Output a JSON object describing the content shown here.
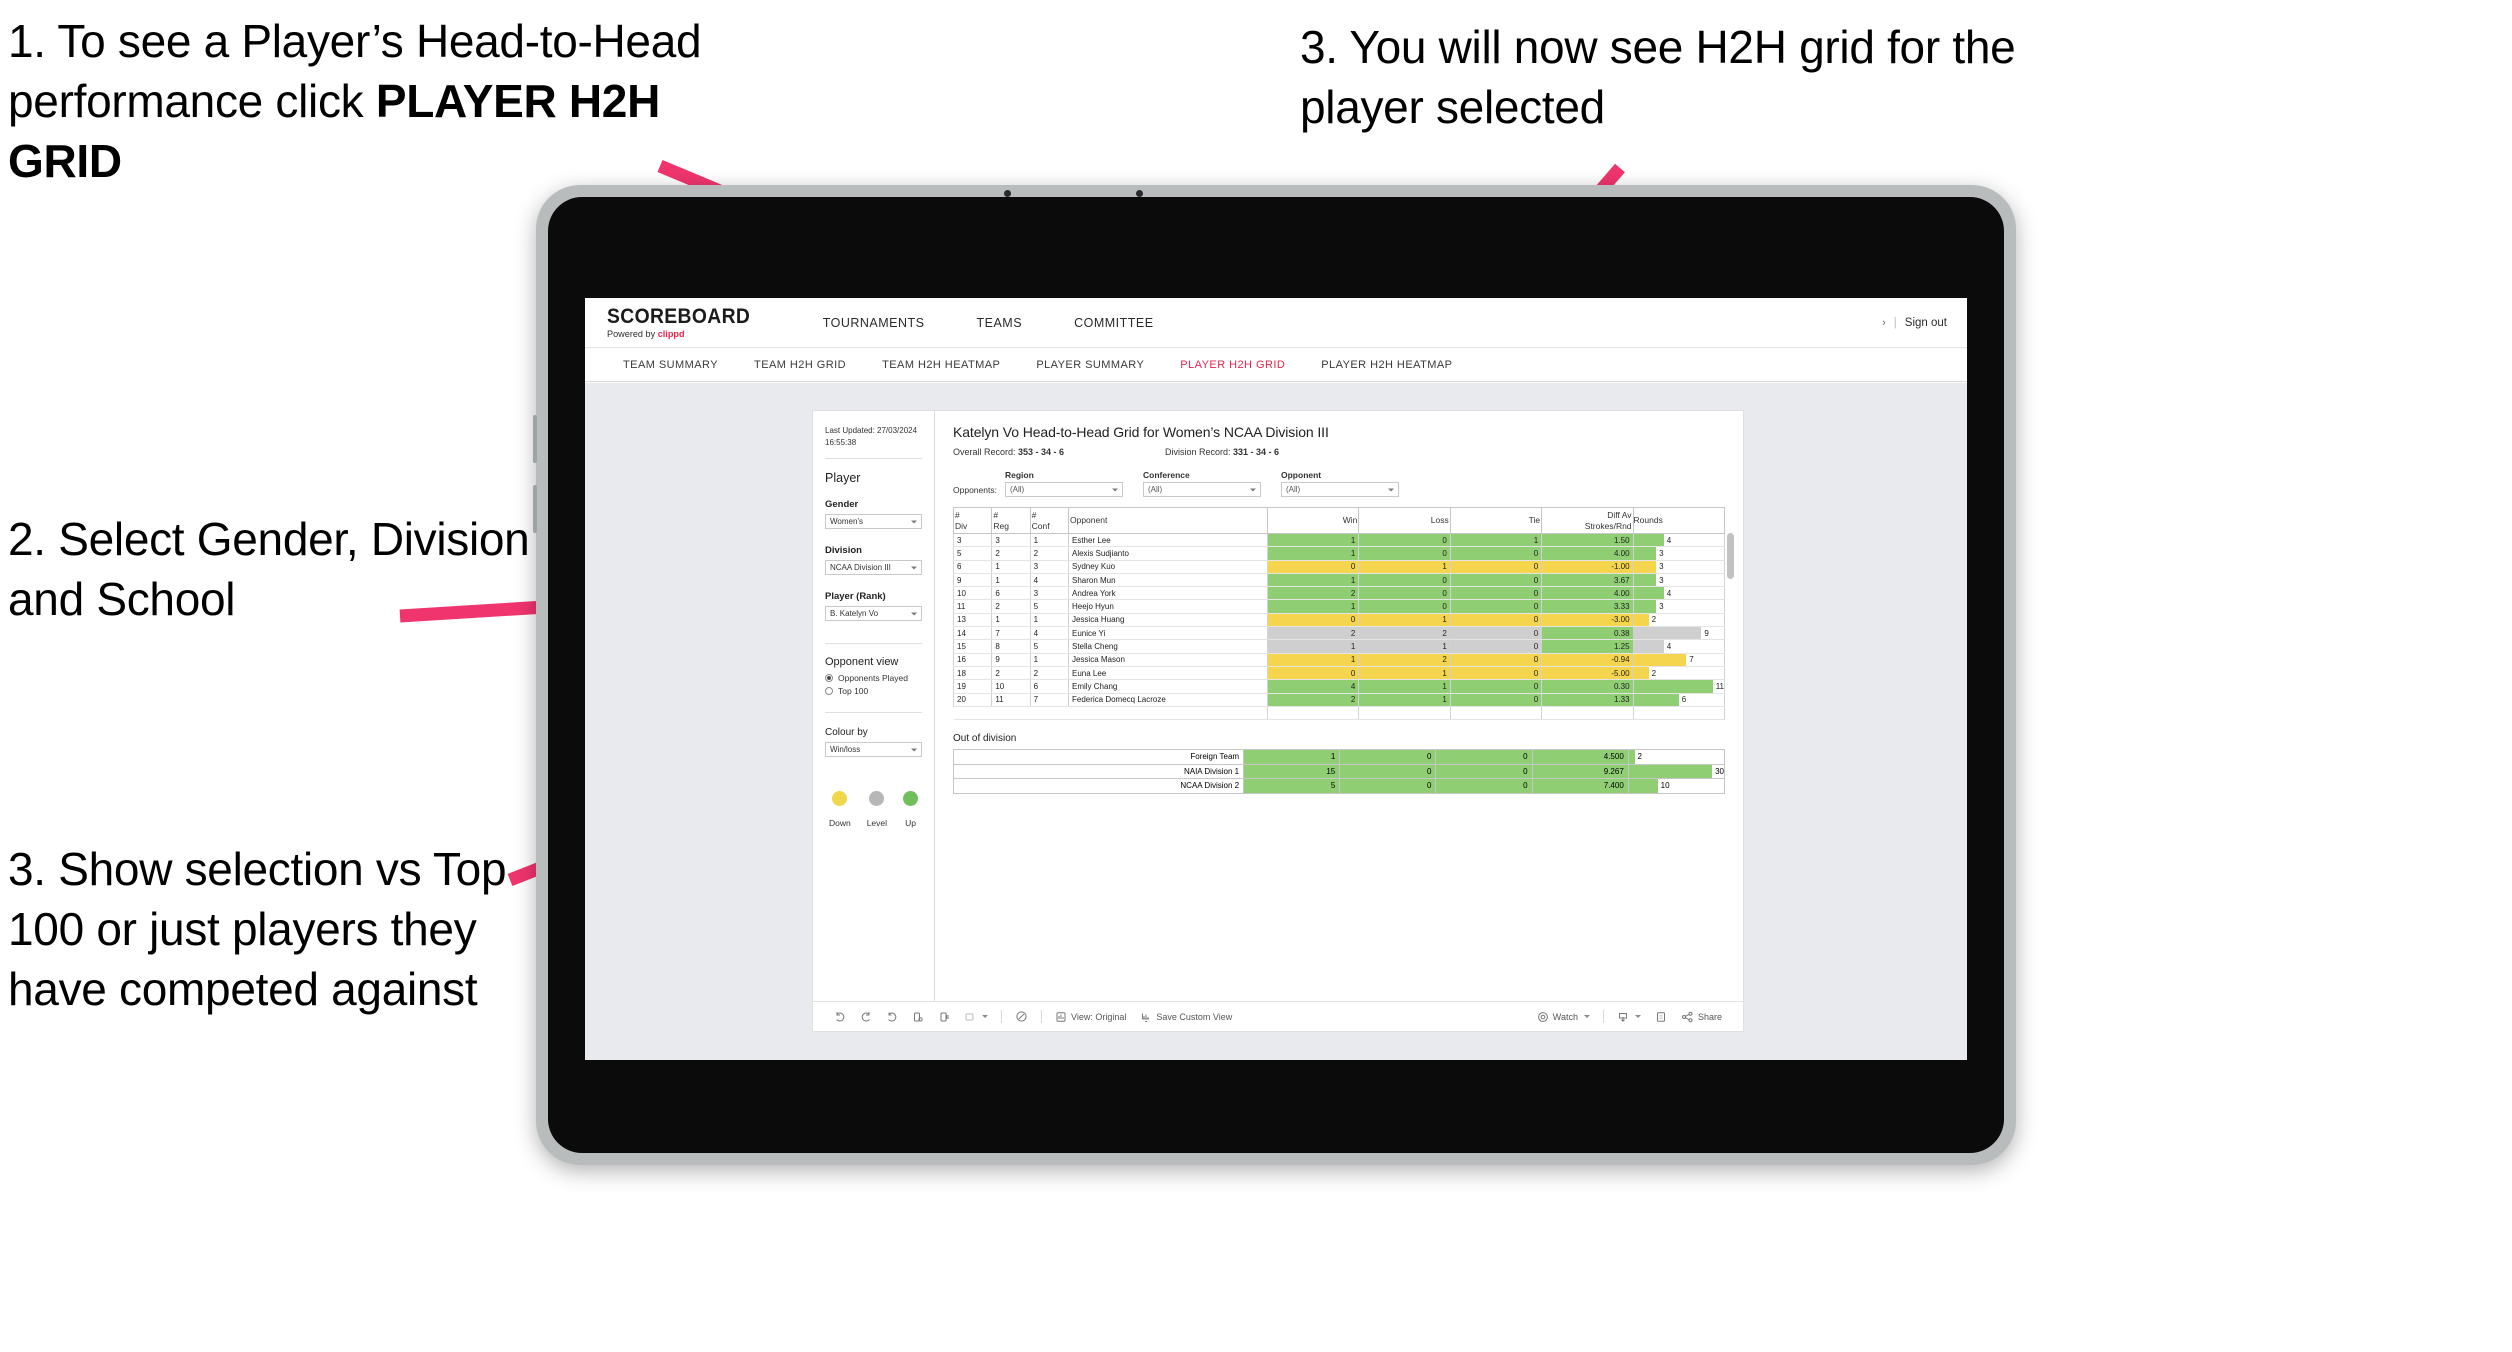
{
  "annotations": {
    "step1": "1. To see a Player’s Head-to-Head performance click ",
    "step1_bold": "PLAYER H2H GRID",
    "step2": "2. Select Gender, Division and School",
    "step3_left": "3. Show selection vs Top 100 or just players they have competed against",
    "step3_right": "3. You will now see H2H grid for the player selected",
    "arrow_color": "#f0356e"
  },
  "header": {
    "brand_name": "SCOREBOARD",
    "brand_sub_prefix": "Powered by ",
    "brand_sub_accent": "clippd",
    "nav": [
      {
        "label": "TOURNAMENTS"
      },
      {
        "label": "TEAMS"
      },
      {
        "label": "COMMITTEE"
      }
    ],
    "chevron": "›",
    "separator": "|",
    "sign_out": "Sign out"
  },
  "subnav": {
    "tabs": [
      {
        "label": "TEAM SUMMARY",
        "active": false
      },
      {
        "label": "TEAM H2H GRID",
        "active": false
      },
      {
        "label": "TEAM H2H HEATMAP",
        "active": false
      },
      {
        "label": "PLAYER SUMMARY",
        "active": false
      },
      {
        "label": "PLAYER H2H GRID",
        "active": true
      },
      {
        "label": "PLAYER H2H HEATMAP",
        "active": false
      }
    ],
    "active_color": "#e8264f"
  },
  "panel": {
    "last_updated_line1": "Last Updated: 27/03/2024",
    "last_updated_line2": "16:55:38",
    "player_heading": "Player",
    "gender_label": "Gender",
    "gender_value": "Women’s",
    "division_label": "Division",
    "division_value": "NCAA Division III",
    "player_rank_label": "Player (Rank)",
    "player_rank_value": "B. Katelyn Vo",
    "opponent_view_heading": "Opponent view",
    "radio_opponents_played": "Opponents Played",
    "radio_top100": "Top 100",
    "colour_by_label": "Colour by",
    "colour_by_value": "Win/loss",
    "legend": [
      {
        "label": "Down",
        "color": "#f0d64b"
      },
      {
        "label": "Level",
        "color": "#b7b7b7"
      },
      {
        "label": "Up",
        "color": "#71bf5c"
      }
    ]
  },
  "viz": {
    "title": "Katelyn Vo Head-to-Head Grid for Women’s NCAA Division III",
    "overall_record_label": "Overall Record: ",
    "overall_record_value": "353 -  34 - 6",
    "division_record_label": "Division Record: ",
    "division_record_value": "331 -  34 - 6",
    "opponents_label": "Opponents:",
    "filters": [
      {
        "label": "Region",
        "value": "(All)"
      },
      {
        "label": "Conference",
        "value": "(All)"
      },
      {
        "label": "Opponent",
        "value": "(All)"
      }
    ],
    "out_of_division_title": "Out of division"
  },
  "chart_data": {
    "type": "table",
    "title": "Katelyn Vo Head-to-Head Grid for Women’s NCAA Division III",
    "columns": [
      "# Div",
      "# Reg",
      "# Conf",
      "Opponent",
      "Win",
      "Loss",
      "Tie",
      "Diff Av Strokes/Rnd",
      "Rounds"
    ],
    "column_header_lines": [
      [
        "#",
        "Div"
      ],
      [
        "#",
        "Reg"
      ],
      [
        "#",
        "Conf"
      ],
      [
        "Opponent"
      ],
      [
        "Win"
      ],
      [
        "Loss"
      ],
      [
        "Tie"
      ],
      [
        "Diff Av",
        "Strokes/Rnd"
      ],
      [
        "Rounds"
      ]
    ],
    "rounds_max": 12,
    "rows": [
      {
        "div": "3",
        "reg": "3",
        "conf": "1",
        "opponent": "Esther Lee",
        "win": "1",
        "loss": "0",
        "tie": "1",
        "diff": "1.50",
        "rounds": "4",
        "color": "g"
      },
      {
        "div": "5",
        "reg": "2",
        "conf": "2",
        "opponent": "Alexis Sudjianto",
        "win": "1",
        "loss": "0",
        "tie": "0",
        "diff": "4.00",
        "rounds": "3",
        "color": "g"
      },
      {
        "div": "6",
        "reg": "1",
        "conf": "3",
        "opponent": "Sydney Kuo",
        "win": "0",
        "loss": "1",
        "tie": "0",
        "diff": "-1.00",
        "rounds": "3",
        "color": "y"
      },
      {
        "div": "9",
        "reg": "1",
        "conf": "4",
        "opponent": "Sharon Mun",
        "win": "1",
        "loss": "0",
        "tie": "0",
        "diff": "3.67",
        "rounds": "3",
        "color": "g"
      },
      {
        "div": "10",
        "reg": "6",
        "conf": "3",
        "opponent": "Andrea York",
        "win": "2",
        "loss": "0",
        "tie": "0",
        "diff": "4.00",
        "rounds": "4",
        "color": "g"
      },
      {
        "div": "11",
        "reg": "2",
        "conf": "5",
        "opponent": "Heejo Hyun",
        "win": "1",
        "loss": "0",
        "tie": "0",
        "diff": "3.33",
        "rounds": "3",
        "color": "g"
      },
      {
        "div": "13",
        "reg": "1",
        "conf": "1",
        "opponent": "Jessica Huang",
        "win": "0",
        "loss": "1",
        "tie": "0",
        "diff": "-3.00",
        "rounds": "2",
        "color": "y"
      },
      {
        "div": "14",
        "reg": "7",
        "conf": "4",
        "opponent": "Eunice Yi",
        "win": "2",
        "loss": "2",
        "tie": "0",
        "diff": "0.38",
        "rounds": "9",
        "color": "gray",
        "diff_color": "g"
      },
      {
        "div": "15",
        "reg": "8",
        "conf": "5",
        "opponent": "Stella Cheng",
        "win": "1",
        "loss": "1",
        "tie": "0",
        "diff": "1.25",
        "rounds": "4",
        "color": "gray",
        "diff_color": "g"
      },
      {
        "div": "16",
        "reg": "9",
        "conf": "1",
        "opponent": "Jessica Mason",
        "win": "1",
        "loss": "2",
        "tie": "0",
        "diff": "-0.94",
        "rounds": "7",
        "color": "y"
      },
      {
        "div": "18",
        "reg": "2",
        "conf": "2",
        "opponent": "Euna Lee",
        "win": "0",
        "loss": "1",
        "tie": "0",
        "diff": "-5.00",
        "rounds": "2",
        "color": "y"
      },
      {
        "div": "19",
        "reg": "10",
        "conf": "6",
        "opponent": "Emily Chang",
        "win": "4",
        "loss": "1",
        "tie": "0",
        "diff": "0.30",
        "rounds": "11",
        "color": "g"
      },
      {
        "div": "20",
        "reg": "11",
        "conf": "7",
        "opponent": "Federica Domecq Lacroze",
        "win": "2",
        "loss": "1",
        "tie": "0",
        "diff": "1.33",
        "rounds": "6",
        "color": "g"
      }
    ],
    "out_of_division": {
      "rounds_max": 33,
      "rows": [
        {
          "name": "Foreign Team",
          "win": "1",
          "loss": "0",
          "tie": "0",
          "diff": "4.500",
          "rounds": "2",
          "color": "g"
        },
        {
          "name": "NAIA Division 1",
          "win": "15",
          "loss": "0",
          "tie": "0",
          "diff": "9.267",
          "rounds": "30",
          "color": "g"
        },
        {
          "name": "NCAA Division 2",
          "win": "5",
          "loss": "0",
          "tie": "0",
          "diff": "7.400",
          "rounds": "10",
          "color": "g"
        }
      ]
    }
  },
  "toolbar": {
    "undo": "undo-icon",
    "redo": "redo-icon",
    "revert": "revert-icon",
    "refresh": "refresh-icon",
    "pause": "pause-icon",
    "zoom": "zoom-icon",
    "alerts": "alerts-icon",
    "view_original": "View: Original",
    "save_custom_view": "Save Custom View",
    "watch": "Watch",
    "download": "download-icon",
    "fullscreen": "fullscreen-icon",
    "share": "Share"
  }
}
